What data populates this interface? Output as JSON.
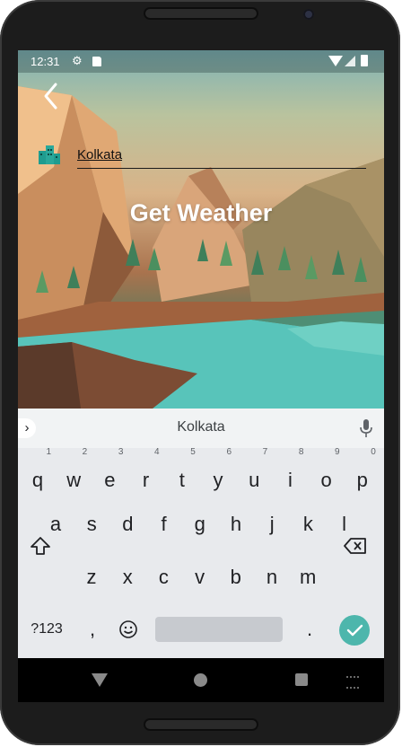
{
  "status_bar": {
    "time": "12:31",
    "settings_icon": "gear-icon",
    "sd_icon": "sd-card-icon"
  },
  "app": {
    "back_icon": "chevron-left-icon",
    "city_icon": "city-buildings-icon",
    "city_value": "Kolkata",
    "title": "Get Weather"
  },
  "keyboard": {
    "suggestion": "Kolkata",
    "row1": [
      {
        "label": "q",
        "hint": "1"
      },
      {
        "label": "w",
        "hint": "2"
      },
      {
        "label": "e",
        "hint": "3"
      },
      {
        "label": "r",
        "hint": "4"
      },
      {
        "label": "t",
        "hint": "5"
      },
      {
        "label": "y",
        "hint": "6"
      },
      {
        "label": "u",
        "hint": "7"
      },
      {
        "label": "i",
        "hint": "8"
      },
      {
        "label": "o",
        "hint": "9"
      },
      {
        "label": "p",
        "hint": "0"
      }
    ],
    "row2": [
      "a",
      "s",
      "d",
      "f",
      "g",
      "h",
      "j",
      "k",
      "l"
    ],
    "row3": [
      "z",
      "x",
      "c",
      "v",
      "b",
      "n",
      "m"
    ],
    "symbols_label": "?123",
    "comma_label": ",",
    "period_label": ".",
    "accent_color": "#4db6ac"
  }
}
